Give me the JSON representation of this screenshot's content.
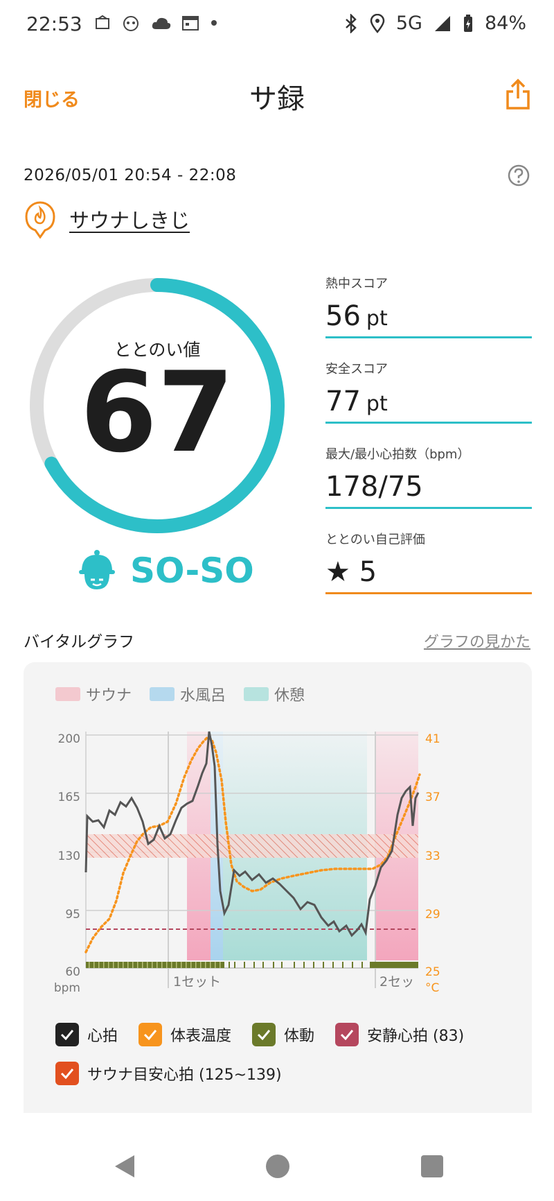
{
  "status_bar": {
    "time": "22:53",
    "network": "5G",
    "battery": "84%",
    "icons": [
      "notification-icon-1",
      "notification-icon-2",
      "cloud-icon",
      "calendar-icon",
      "dot-icon",
      "bluetooth-icon",
      "location-icon",
      "signal-icon",
      "battery-icon"
    ]
  },
  "header": {
    "close_label": "閉じる",
    "title": "サ録",
    "share_icon": "share-icon"
  },
  "session": {
    "datetime": "2026/05/01 20:54 - 22:08",
    "facility": "サウナしきじ"
  },
  "score": {
    "label": "ととのい値",
    "value": "67",
    "fraction": 0.67,
    "status": "SO-SO"
  },
  "stats": [
    {
      "label": "熱中スコア",
      "value": "56",
      "unit": "pt"
    },
    {
      "label": "安全スコア",
      "value": "77",
      "unit": "pt"
    },
    {
      "label": "最大/最小心拍数（bpm）",
      "value": "178/75",
      "unit": ""
    },
    {
      "label": "ととのい自己評価",
      "value": "★ 5",
      "unit": ""
    }
  ],
  "graph": {
    "title": "バイタルグラフ",
    "link": "グラフの見かた",
    "legend": [
      {
        "label": "サウナ",
        "color": "#f3c9cf"
      },
      {
        "label": "水風呂",
        "color": "#b5d9ee"
      },
      {
        "label": "休憩",
        "color": "#b7e3df"
      }
    ],
    "left_ticks": [
      "200",
      "165",
      "130",
      "95",
      "60"
    ],
    "left_unit": "bpm",
    "right_ticks": [
      "41",
      "37",
      "33",
      "29",
      "25"
    ],
    "right_unit": "°C",
    "set_labels": [
      "1セット",
      "2セッ"
    ],
    "checkboxes": [
      {
        "label": "心拍",
        "color": "#222222"
      },
      {
        "label": "体表温度",
        "color": "#f7941d"
      },
      {
        "label": "体動",
        "color": "#6b7a2a"
      },
      {
        "label": "安静心拍 (83)",
        "color": "#b5475e"
      },
      {
        "label": "サウナ目安心拍 (125~139)",
        "color": "#e2501f"
      }
    ]
  }
}
